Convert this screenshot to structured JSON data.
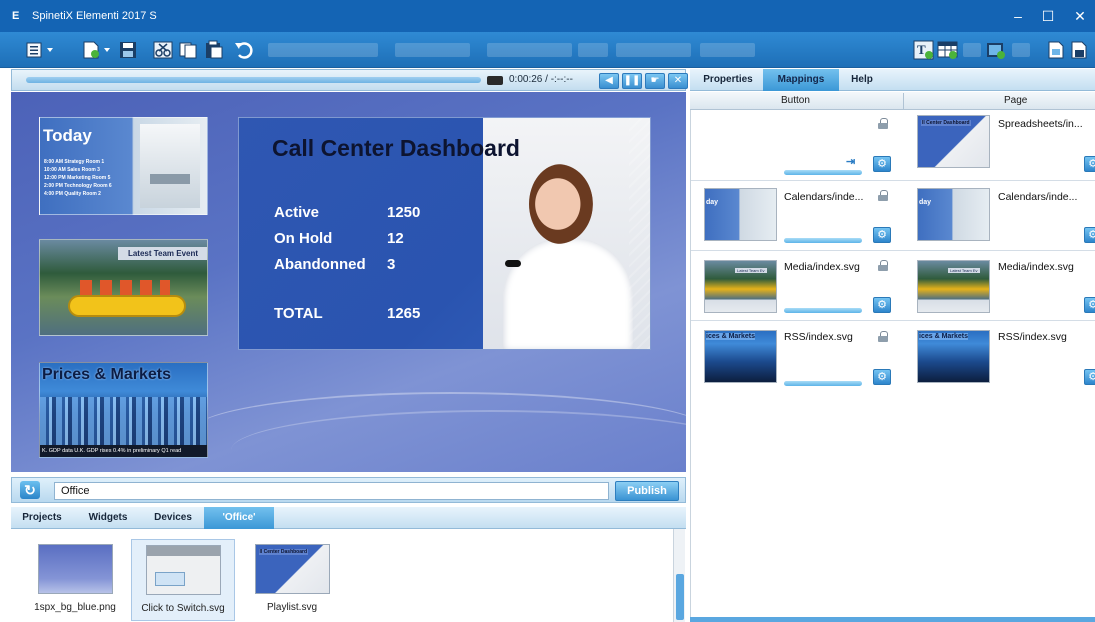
{
  "window": {
    "title": "SpinetiX Elementi 2017 S",
    "app_icon": "E",
    "minimize": "–",
    "maximize": "☐",
    "close": "✕"
  },
  "player": {
    "timecode": "0:00:26 / -:--:--"
  },
  "stage": {
    "today": {
      "title": "Today",
      "schedule": [
        "8:00 AM  Strategy      Room 1",
        "10:00 AM  Sales         Room 3",
        "12:00 PM  Marketing   Room 5",
        "2:00 PM  Technology   Room 6",
        "4:00 PM  Quality       Room 2"
      ]
    },
    "event": {
      "banner": "Latest Team Event"
    },
    "prices": {
      "title": "Prices & Markets",
      "ticker": "K. GDP data     U.K. GDP rises 0.4% in preliminary Q1 read"
    },
    "dashboard": {
      "title": "Call Center Dashboard",
      "metrics": [
        {
          "label": "Active",
          "value": "1250"
        },
        {
          "label": "On Hold",
          "value": "12"
        },
        {
          "label": "Abandonned",
          "value": "3"
        },
        {
          "label": "TOTAL",
          "value": "1265"
        }
      ]
    }
  },
  "project": {
    "name": "Office",
    "publish_label": "Publish"
  },
  "bottom_tabs": [
    "Projects",
    "Widgets",
    "Devices",
    "'Office'"
  ],
  "assets": [
    {
      "name": "1spx_bg_blue.png"
    },
    {
      "name": "Click to Switch.svg"
    },
    {
      "name": "Playlist.svg"
    }
  ],
  "right_tabs": [
    "Properties",
    "Mappings",
    "Help"
  ],
  "mapping_columns": {
    "button": "Button",
    "page": "Page"
  },
  "mappings": [
    {
      "button": "",
      "page": "Spreadsheets/in..."
    },
    {
      "button": "Calendars/inde...",
      "page": "Calendars/inde..."
    },
    {
      "button": "Media/index.svg",
      "page": "Media/index.svg"
    },
    {
      "button": "RSS/index.svg",
      "page": "RSS/index.svg"
    }
  ],
  "thumbs": {
    "dash_label": "ll Center Dashboard",
    "today_label": "day",
    "media_label": "Latest Team Ev",
    "rss_label": "ices & Markets"
  },
  "colors": {
    "titlebar": "#1464b4",
    "accent": "#3b97d6",
    "stage": "#4c62b8"
  },
  "icons": [
    "refresh-icon",
    "lock-icon",
    "gear-icon",
    "link-arrow-icon",
    "speaker-icon",
    "pause-icon",
    "hand-icon",
    "close-icon"
  ]
}
